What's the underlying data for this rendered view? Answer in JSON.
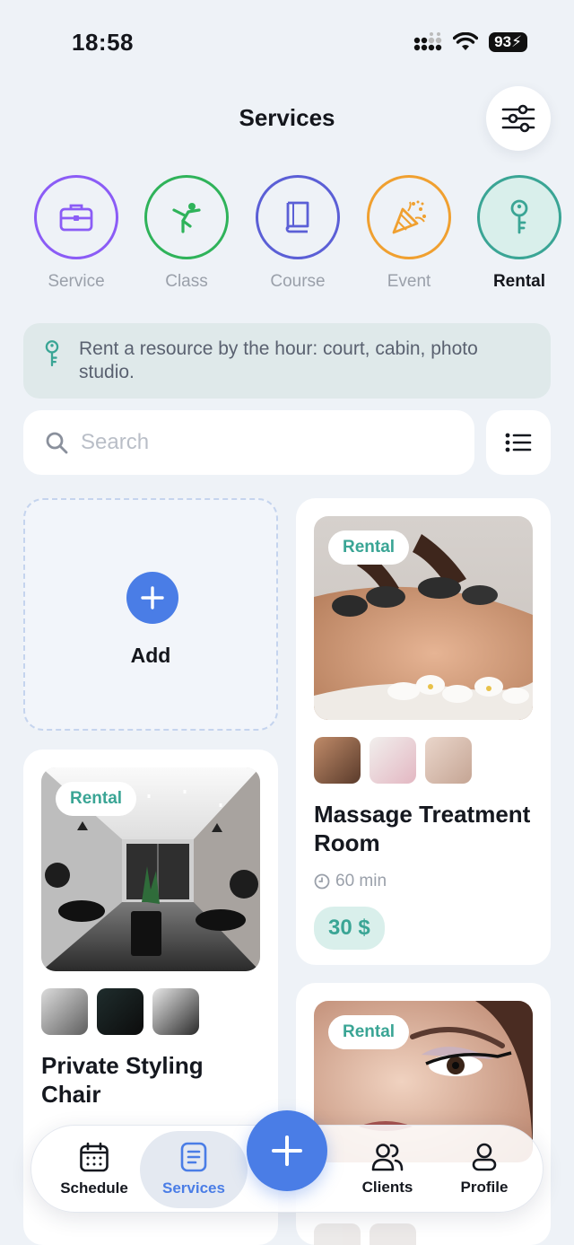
{
  "status_bar": {
    "time": "18:58",
    "battery": "93"
  },
  "header": {
    "title": "Services"
  },
  "categories": [
    {
      "label": "Service",
      "icon": "briefcase-icon",
      "color": "#8b5cf6"
    },
    {
      "label": "Class",
      "icon": "stretch-figure-icon",
      "color": "#2fb35a"
    },
    {
      "label": "Course",
      "icon": "book-icon",
      "color": "#5b5fd6"
    },
    {
      "label": "Event",
      "icon": "party-popper-icon",
      "color": "#f0a030"
    },
    {
      "label": "Rental",
      "icon": "key-icon",
      "color": "#3aa595",
      "active": true
    }
  ],
  "info": {
    "text": "Rent a resource by the hour: court, cabin, photo studio."
  },
  "search": {
    "placeholder": "Search"
  },
  "add_card": {
    "label": "Add"
  },
  "cards": [
    {
      "badge": "Rental",
      "title": "Massage Treatment Room",
      "duration": "60 min",
      "price": "30 $"
    },
    {
      "badge": "Rental",
      "title": "Private Styling Chair"
    },
    {
      "badge": "Rental"
    }
  ],
  "bottom_nav": {
    "items": [
      {
        "label": "Schedule",
        "icon": "calendar-icon"
      },
      {
        "label": "Services",
        "icon": "document-icon",
        "active": true
      },
      {
        "label": "Clients",
        "icon": "users-icon"
      },
      {
        "label": "Profile",
        "icon": "user-icon"
      }
    ]
  },
  "colors": {
    "accent": "#4a7de6",
    "rental": "#3aa595",
    "background": "#eef2f7"
  }
}
